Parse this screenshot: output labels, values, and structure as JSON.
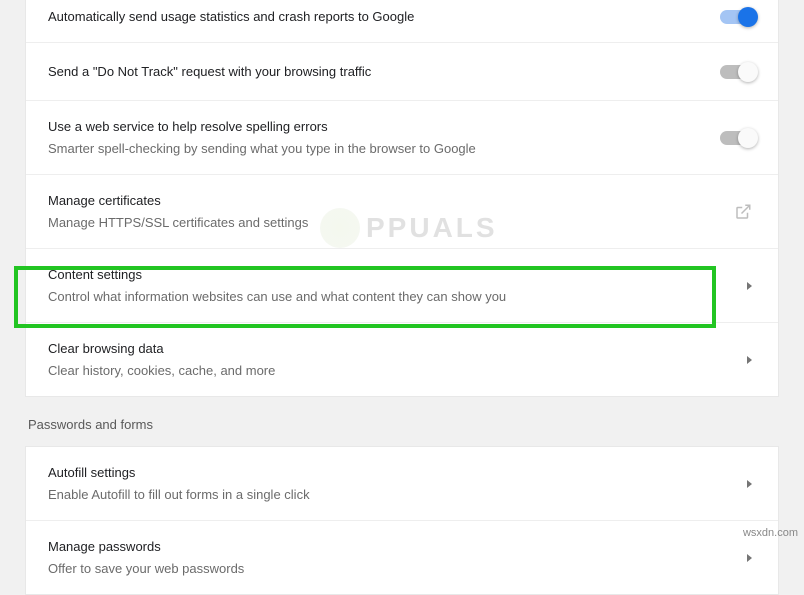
{
  "privacy": {
    "usage_stats": {
      "title": "Automatically send usage statistics and crash reports to Google"
    },
    "dnt": {
      "title": "Send a \"Do Not Track\" request with your browsing traffic"
    },
    "spelling": {
      "title": "Use a web service to help resolve spelling errors",
      "sub": "Smarter spell-checking by sending what you type in the browser to Google"
    },
    "certs": {
      "title": "Manage certificates",
      "sub": "Manage HTTPS/SSL certificates and settings"
    },
    "content": {
      "title": "Content settings",
      "sub": "Control what information websites can use and what content they can show you"
    },
    "clear": {
      "title": "Clear browsing data",
      "sub": "Clear history, cookies, cache, and more"
    }
  },
  "section_passwords": "Passwords and forms",
  "pw": {
    "autofill": {
      "title": "Autofill settings",
      "sub": "Enable Autofill to fill out forms in a single click"
    },
    "manage": {
      "title": "Manage passwords",
      "sub": "Offer to save your web passwords"
    }
  },
  "watermark": "PPUALS",
  "attrib": "wsxdn.com"
}
